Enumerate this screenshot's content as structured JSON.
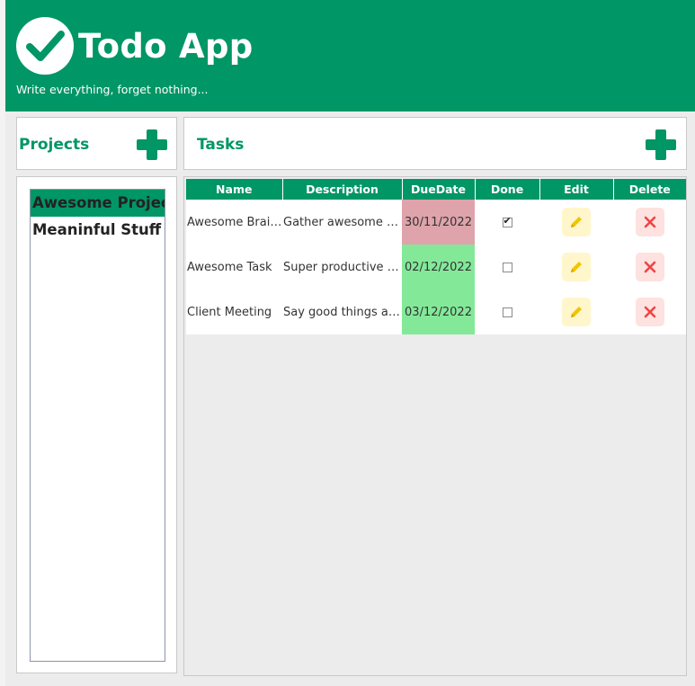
{
  "header": {
    "title": "Todo App",
    "subtitle": "Write everything, forget nothing...",
    "logo_icon": "check-circle-icon"
  },
  "projects": {
    "title": "Projects",
    "add_icon": "plus-icon",
    "items": [
      {
        "label": "Awesome Project",
        "selected": true
      },
      {
        "label": "Meaninful Stuff",
        "selected": false
      }
    ]
  },
  "tasks": {
    "title": "Tasks",
    "add_icon": "plus-icon",
    "columns": [
      "Name",
      "Description",
      "DueDate",
      "Done",
      "Edit",
      "Delete"
    ],
    "rows": [
      {
        "name": "Awesome Brain...",
        "description": "Gather awesome te...",
        "due": "30/11/2022",
        "due_status": "overdue",
        "done": true
      },
      {
        "name": "Awesome Task",
        "description": "Super productive th...",
        "due": "02/12/2022",
        "due_status": "ok",
        "done": false
      },
      {
        "name": "Client Meeting",
        "description": "Say good things ab...",
        "due": "03/12/2022",
        "due_status": "ok",
        "done": false
      }
    ]
  },
  "colors": {
    "brand": "#009665",
    "overdue": "#dea3ab",
    "ok": "#83e999",
    "edit_bg": "#fff6cc",
    "delete_bg": "#fde2e0"
  }
}
